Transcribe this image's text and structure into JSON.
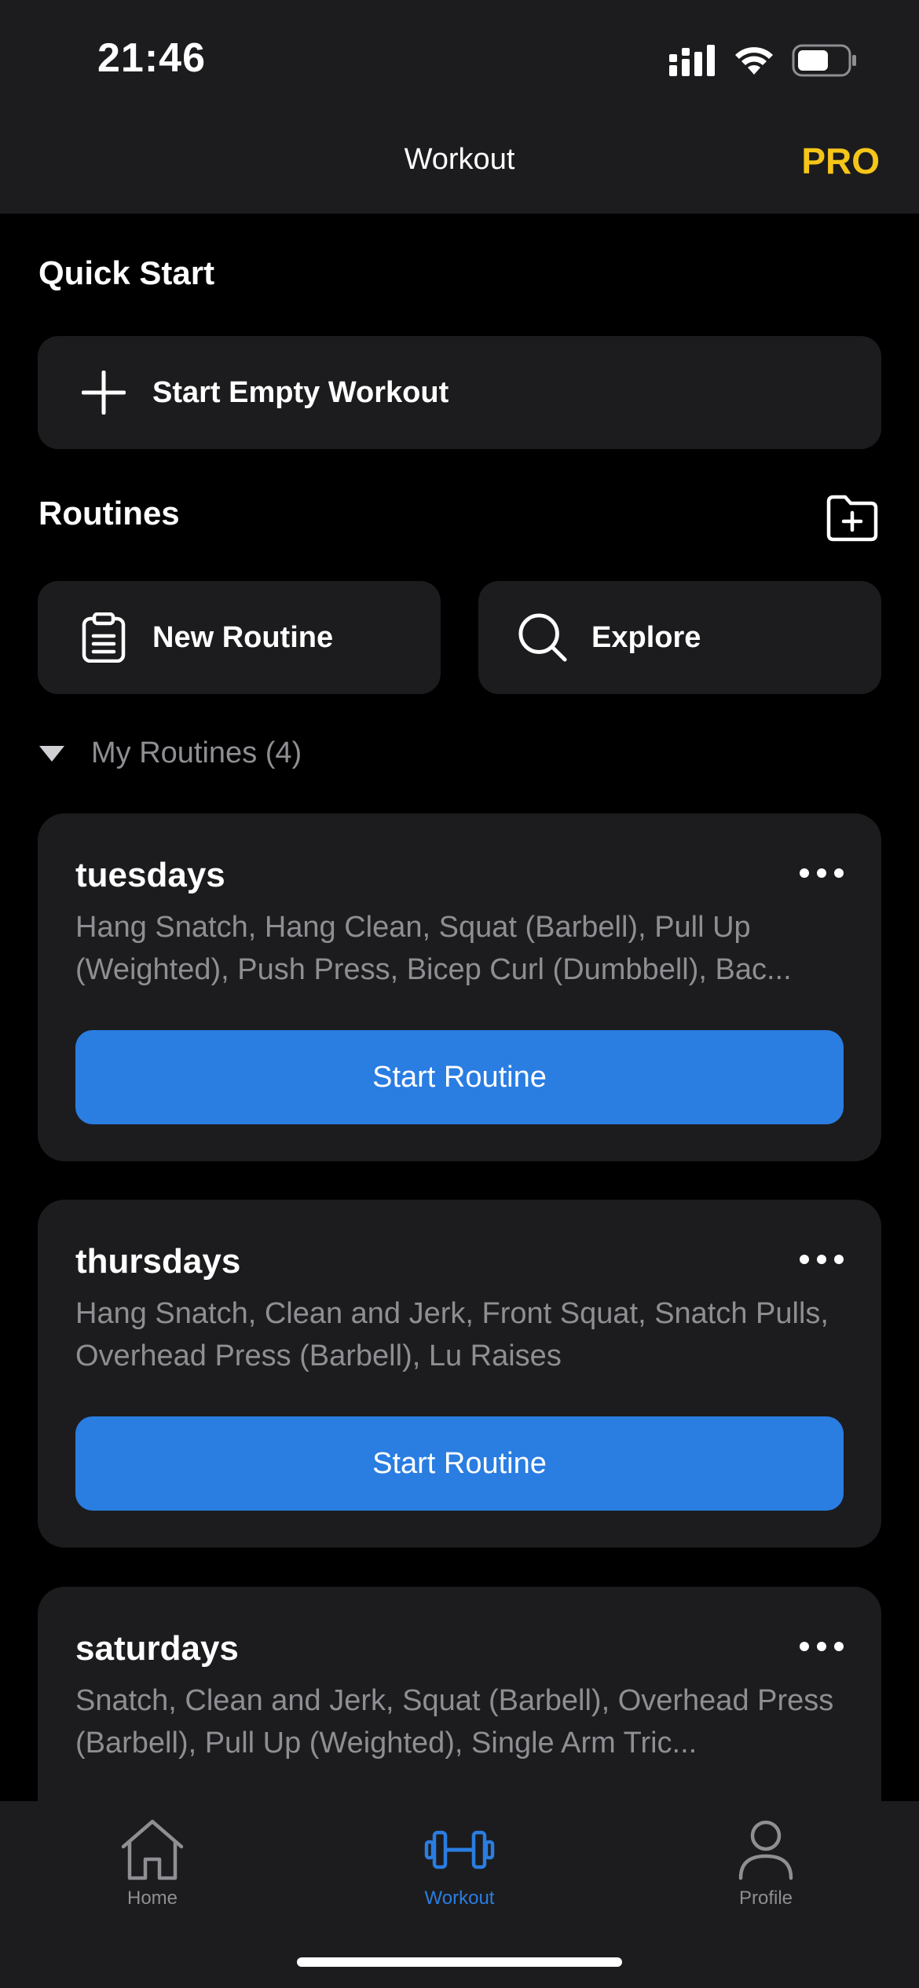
{
  "status_bar": {
    "time": "21:46"
  },
  "header": {
    "title": "Workout",
    "pro_label": "PRO"
  },
  "quick_start": {
    "title": "Quick Start",
    "start_empty_label": "Start Empty Workout"
  },
  "routines": {
    "title": "Routines",
    "new_routine_label": "New Routine",
    "explore_label": "Explore",
    "my_routines_label": "My Routines (4)",
    "start_routine_label": "Start Routine",
    "items": [
      {
        "name": "tuesdays",
        "exercises": "Hang Snatch, Hang Clean, Squat (Barbell), Pull Up (Weighted), Push Press, Bicep Curl (Dumbbell), Bac..."
      },
      {
        "name": "thursdays",
        "exercises": "Hang Snatch, Clean and Jerk, Front Squat, Snatch Pulls, Overhead Press (Barbell), Lu Raises"
      },
      {
        "name": "saturdays",
        "exercises": "Snatch, Clean and Jerk, Squat (Barbell), Overhead Press (Barbell), Pull Up (Weighted), Single Arm Tric..."
      }
    ]
  },
  "tabbar": {
    "home_label": "Home",
    "workout_label": "Workout",
    "profile_label": "Profile"
  },
  "colors": {
    "accent": "#2a7de1",
    "pro": "#f5c518",
    "card": "#1c1c1e",
    "background": "#000000",
    "secondary_text": "#8e8e93"
  }
}
